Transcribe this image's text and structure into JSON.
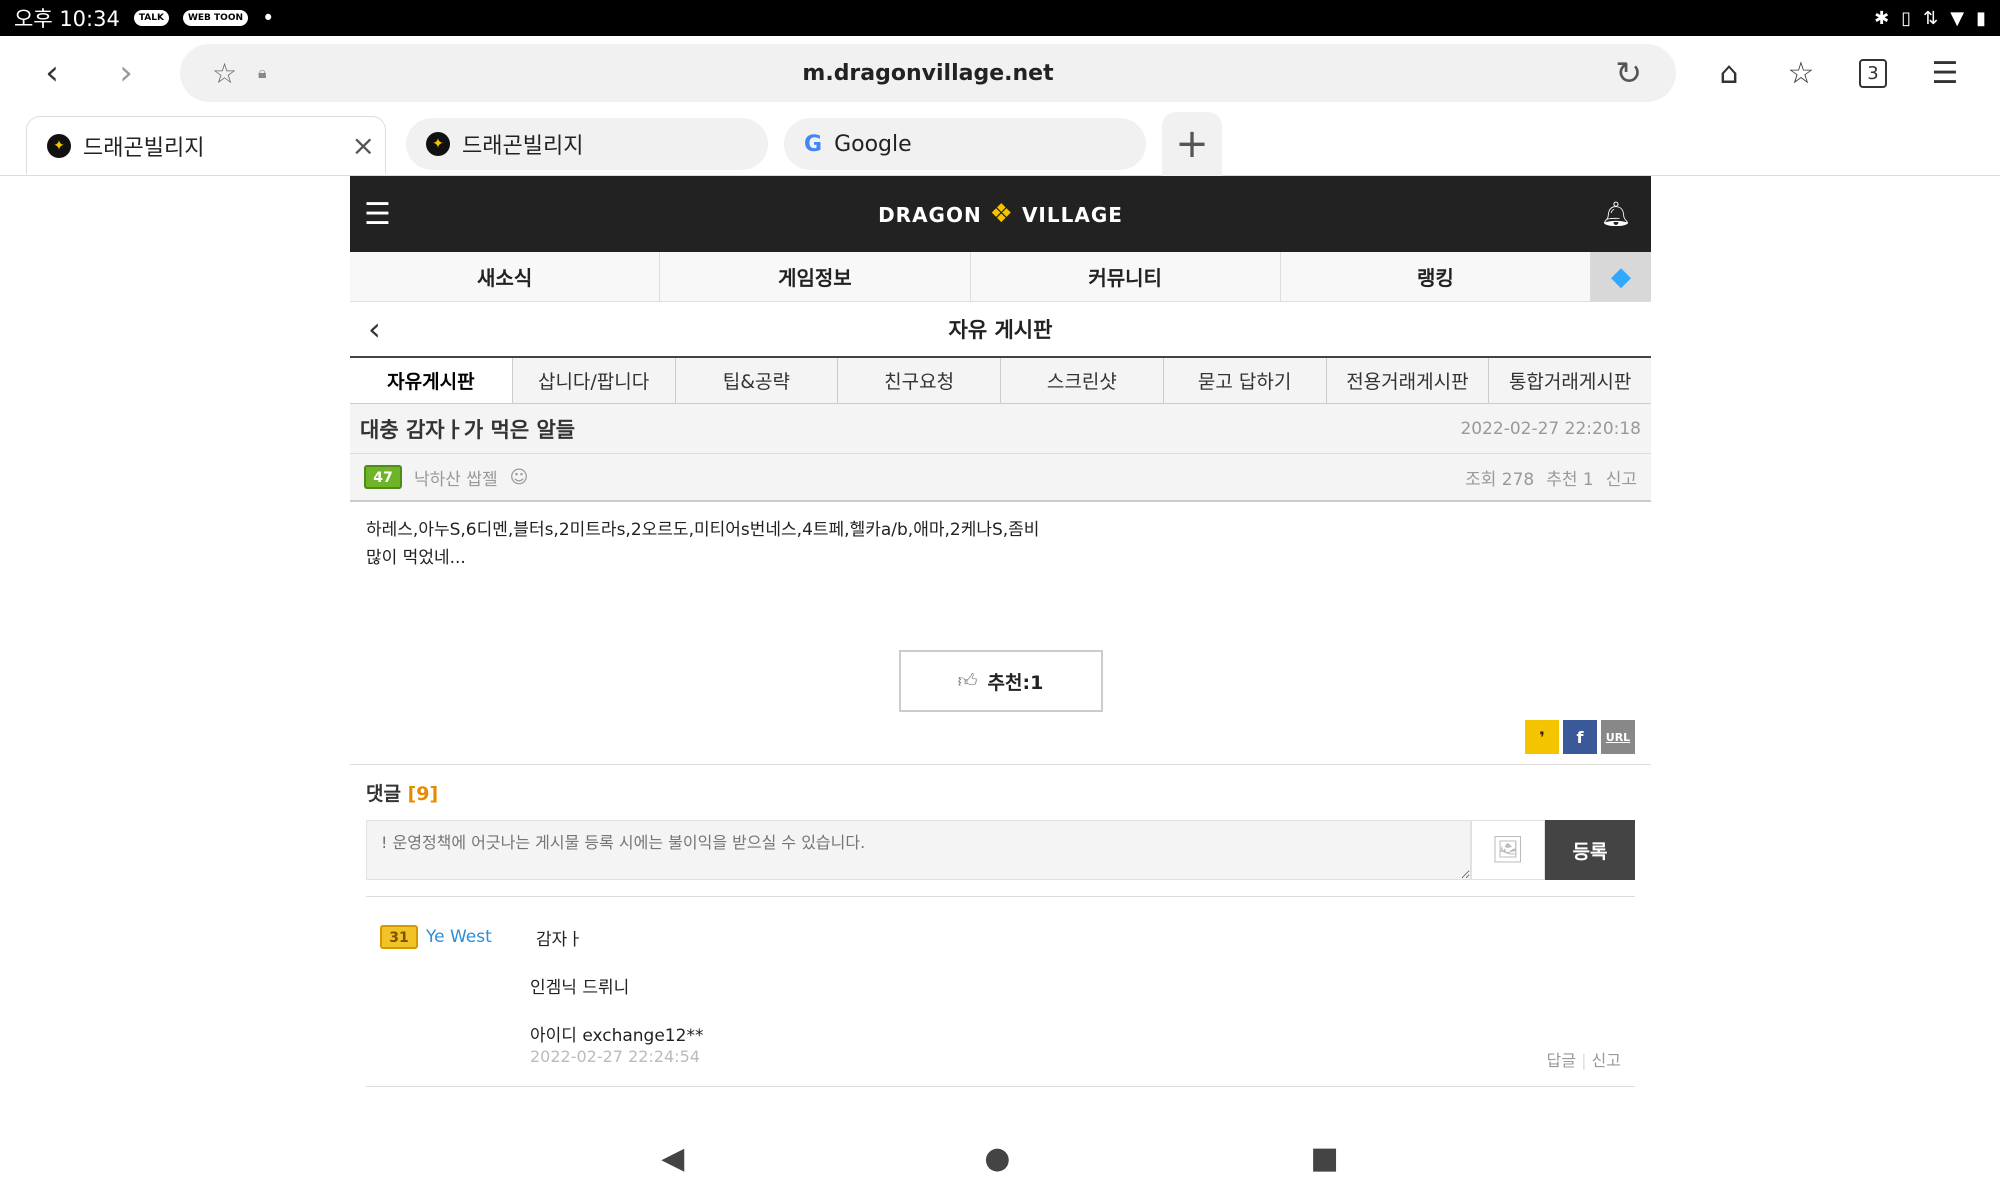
{
  "status_bar": {
    "time": "오후 10:34",
    "talk_label": "TALK",
    "webtoon_label": "WEB TOON",
    "dot": "•"
  },
  "browser": {
    "url": "m.dragonvillage.net",
    "tabs": [
      {
        "label": "드래곤빌리지"
      },
      {
        "label": "드래곤빌리지"
      },
      {
        "label": "Google"
      }
    ],
    "tab_count": "3"
  },
  "site": {
    "logo_left": "DRAGON",
    "logo_right": "VILLAGE",
    "nav": [
      "새소식",
      "게임정보",
      "커뮤니티",
      "랭킹"
    ],
    "board_title": "자유 게시판",
    "subtabs": [
      "자유게시판",
      "삽니다/팝니다",
      "팁&공략",
      "친구요청",
      "스크린샷",
      "묻고 답하기",
      "전용거래게시판",
      "통합거래게시판"
    ]
  },
  "post": {
    "title": "대충 감자ㅏ가 먹은 알들",
    "date": "2022-02-27 22:20:18",
    "author_level": "47",
    "author": "낙하산 쌉젤",
    "views": "조회 278",
    "recommends": "추천 1",
    "report": "신고",
    "body_line1": "하레스,아누S,6디멘,블터s,2미트라s,2오르도,미티어s번네스,4트페,헬카a/b,애마,2케나S,좀비",
    "body_line2": "많이 먹었네...",
    "recommend_button": "추천:1",
    "share_url": "URL"
  },
  "comments": {
    "header": "댓글",
    "count": "[9]",
    "placeholder": "! 운영정책에 어긋나는 게시물 등록 시에는 불이익을 받으실 수 있습니다.",
    "submit": "등록",
    "items": [
      {
        "level": "31",
        "author": "Ye West",
        "line1": "감자ㅏ",
        "line2": "인겜닉 드뤼니",
        "line3": "아이디 exchange12**",
        "date": "2022-02-27 22:24:54",
        "reply": "답글",
        "report": "신고"
      }
    ]
  }
}
